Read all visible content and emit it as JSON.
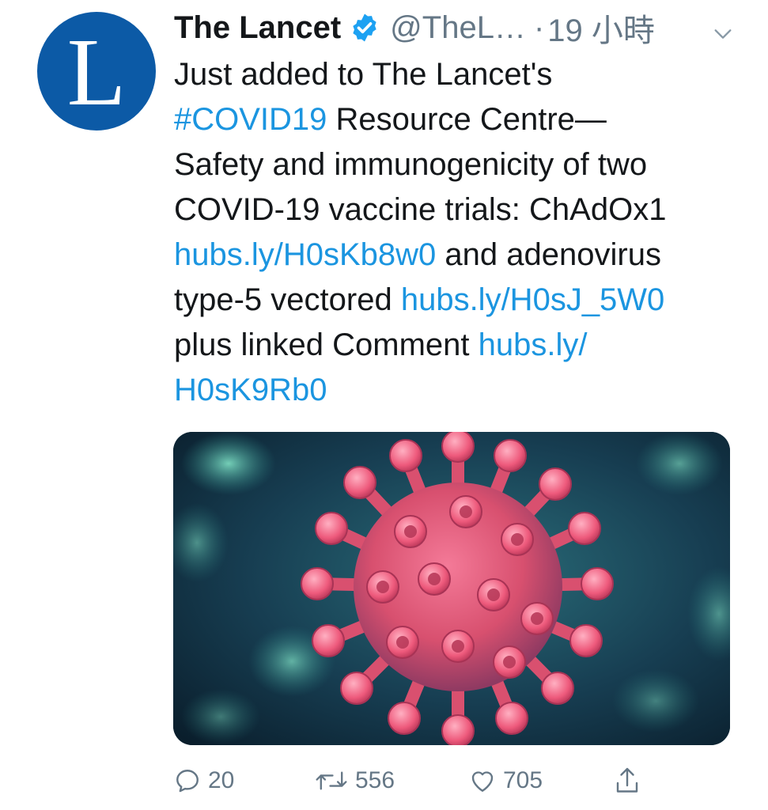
{
  "account": {
    "name": "The Lancet",
    "handle": "@TheL…",
    "separator": "·",
    "time": "19 小時",
    "avatar_letter": "L",
    "avatar_color": "#0c5aa6"
  },
  "tweet": {
    "line1": "Just added to The Lancet's",
    "hashtag": "#COVID19",
    "line2_rest": " Resource Centre—",
    "line3": "Safety and immunogenicity of two",
    "line4": "COVID-19 vaccine trials: ChAdOx1",
    "link1": "hubs.ly/H0sKb8w0",
    "line5_rest": " and adenovirus",
    "line6_start": "type-5 vectored ",
    "link2": "hubs.ly/H0sJ_5W0",
    "line7_start": "plus linked Comment ",
    "link3_part1": "hubs.ly/",
    "link3_part2": "H0sK9Rb0"
  },
  "media": {
    "icon": "coronavirus-illustration"
  },
  "actions": {
    "reply_count": "20",
    "retweet_count": "556",
    "like_count": "705"
  },
  "colors": {
    "link": "#1b95e0",
    "secondary": "#657786",
    "verified": "#1da1f2"
  }
}
